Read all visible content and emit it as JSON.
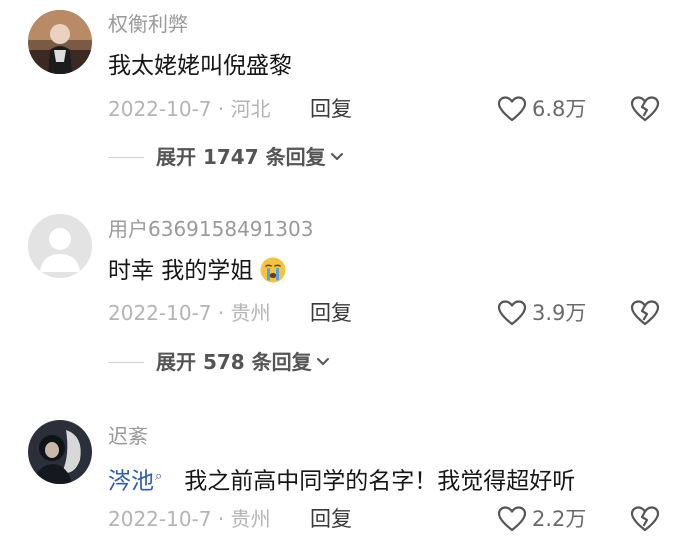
{
  "comments": [
    {
      "username": "权衡利弊",
      "content": "我太姥姥叫倪盛黎",
      "meta": "2022-10-7 · 河北",
      "reply_label": "回复",
      "likes": "6.8万",
      "expand_label": "展开 1747 条回复"
    },
    {
      "username": "用户6369158491303",
      "content": "时幸 我的学姐",
      "emoji": "loudly-crying-face",
      "meta": "2022-10-7 · 贵州",
      "reply_label": "回复",
      "likes": "3.9万",
      "expand_label": "展开 578 条回复"
    },
    {
      "username": "迟紊",
      "mention": "涔池",
      "content": "我之前高中同学的名字！我觉得超好听",
      "meta": "2022-10-7 · 贵州",
      "reply_label": "回复",
      "likes": "2.2万"
    }
  ],
  "colors": {
    "username": "#9a9a9a",
    "content": "#161616",
    "meta": "#b4b4b4",
    "mention": "#2f5ea8"
  },
  "icons": {
    "like": "heart-outline-icon",
    "dislike": "broken-heart-icon",
    "expand": "chevron-down-icon",
    "mention_badge": "search-small-icon"
  }
}
